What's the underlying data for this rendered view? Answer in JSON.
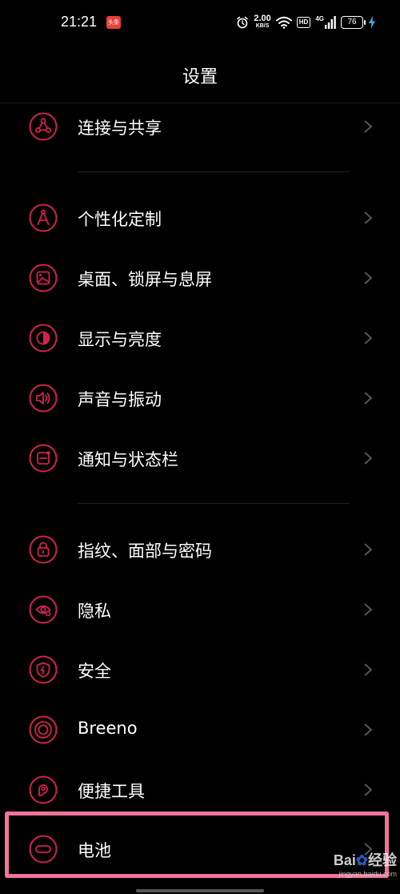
{
  "status_bar": {
    "time": "21:21",
    "app_badge": "头条",
    "net_speed_value": "2.00",
    "net_speed_unit": "KB/S",
    "hd_label": "HD",
    "network_type": "4G",
    "battery_level": "76"
  },
  "header": {
    "title": "设置"
  },
  "settings": {
    "items": [
      {
        "label": "连接与共享",
        "icon": "share-connect-icon"
      },
      {
        "label": "个性化定制",
        "icon": "compass-icon"
      },
      {
        "label": "桌面、锁屏与息屏",
        "icon": "wallpaper-icon"
      },
      {
        "label": "显示与亮度",
        "icon": "brightness-icon"
      },
      {
        "label": "声音与振动",
        "icon": "speaker-icon"
      },
      {
        "label": "通知与状态栏",
        "icon": "notification-icon"
      },
      {
        "label": "指纹、面部与密码",
        "icon": "lock-icon"
      },
      {
        "label": "隐私",
        "icon": "privacy-eye-icon"
      },
      {
        "label": "安全",
        "icon": "security-shield-icon"
      },
      {
        "label": "Breeno",
        "icon": "breeno-icon"
      },
      {
        "label": "便捷工具",
        "icon": "tools-icon"
      },
      {
        "label": "电池",
        "icon": "battery-icon"
      }
    ]
  },
  "watermark": {
    "brand_left": "Bai",
    "brand_right": "经验",
    "url": "jingyan.baidu.com"
  },
  "colors": {
    "accent": "#d2234a",
    "highlight": "#f0739a",
    "background": "#000000",
    "text": "#ffffff"
  }
}
